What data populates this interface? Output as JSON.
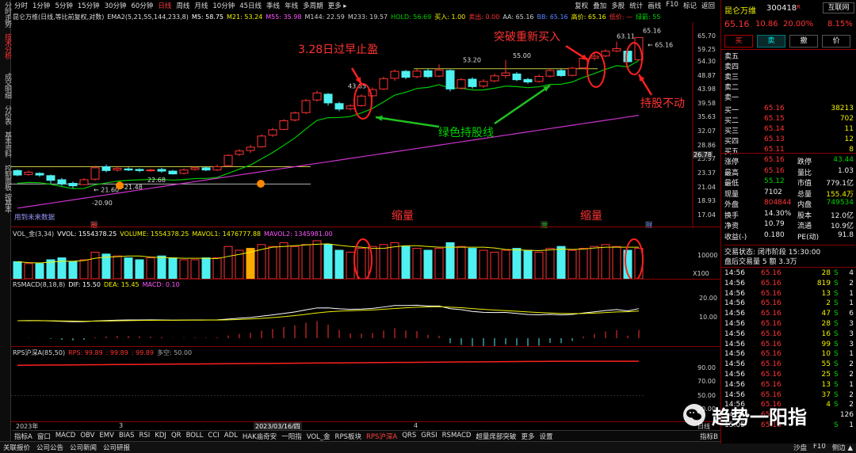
{
  "left_tabs": [
    {
      "label": "分时走势",
      "active": false
    },
    {
      "label": "技术分析",
      "active": true
    },
    {
      "label": "成交明细",
      "active": false
    },
    {
      "label": "分价表",
      "active": false
    },
    {
      "label": "基本资料",
      "active": false
    },
    {
      "label": "控制面板",
      "active": false
    },
    {
      "label": "按基本",
      "active": false
    }
  ],
  "period_tabs": [
    {
      "label": "分时",
      "active": false
    },
    {
      "label": "1分钟",
      "active": false
    },
    {
      "label": "5分钟",
      "active": false
    },
    {
      "label": "15分钟",
      "active": false
    },
    {
      "label": "30分钟",
      "active": false
    },
    {
      "label": "60分钟",
      "active": false
    },
    {
      "label": "日线",
      "active": true
    },
    {
      "label": "周线",
      "active": false
    },
    {
      "label": "月线",
      "active": false
    },
    {
      "label": "10分钟",
      "active": false
    },
    {
      "label": "45日线",
      "active": false
    },
    {
      "label": "季线",
      "active": false
    },
    {
      "label": "年线",
      "active": false
    },
    {
      "label": "多周期",
      "active": false
    },
    {
      "label": "更多 ▸",
      "active": false
    }
  ],
  "right_tools": [
    "复权",
    "叠加",
    "多股",
    "统计",
    "画线",
    "F10",
    "标记",
    "返回"
  ],
  "main_legend": {
    "stock": "昆仑万维(日线,等比前复权,对数)",
    "indicator": "EMA2(5,21,55,144,233,8)",
    "m5": "M5: 58.75",
    "m21": "M21: 53.24",
    "m55": "M55: 35.98",
    "m144": "M144: 22.59",
    "m233": "M233: 19.57",
    "hold": "HOLD: 56.69",
    "buy": "买入: 1.00",
    "sell": "卖出: 0.00",
    "aa": "AA: 65.16",
    "bb": "BB: 65.16",
    "high": "高价: 65.16",
    "low": "低价: —",
    "lvjian": "绿箭: 55"
  },
  "main_axis": [
    "65.70",
    "59.25",
    "54.30",
    "48.87",
    "43.98",
    "39.58",
    "35.63",
    "32.07",
    "28.86",
    "25.97",
    "23.37",
    "21.04",
    "18.93",
    "17.04"
  ],
  "main_axis_highlight": "26.78",
  "price_labels": {
    "p6311": "63.11",
    "p6516a": "65.16",
    "p6516b": "← 65.16",
    "p5500": "55.00",
    "p5320": "53.20",
    "p4365": "43.65",
    "p2160": "← 21.60",
    "p2090": "-20.90",
    "p2148": "-21.48",
    "p2268": "22.68"
  },
  "watermark_text": "用到未来数据",
  "annotations": {
    "a1": "3.28日过早止盈",
    "a2": "突破重新买入",
    "a3": "绿色持股线",
    "a4": "持股不动",
    "a5": "缩量",
    "a6": "缩量"
  },
  "vol_legend": {
    "name": "VOL_金(3,34)",
    "vvol": "VVOL: 1554378.25",
    "volume": "VOLUME: 1554378.25",
    "mavol1": "MAVOL1: 1476777.88",
    "mavol2": "MAVOL2: 1345981.00"
  },
  "vol_axis": [
    "10000",
    "X100"
  ],
  "macd_legend": {
    "name": "RSMACD(8,18,8)",
    "dif": "DIF: 15.50",
    "dea": "DEA: 15.45",
    "macd": "MACD: 0.10"
  },
  "macd_axis": [
    "20.00",
    "10.00"
  ],
  "rps_legend": {
    "name": "RPS沪深A(85,50)",
    "rps": "RPS: 99.89",
    "v2": ": 99.89",
    "v3": ": 99.89",
    "duokong": "多空: 50.00"
  },
  "rps_axis": [
    "90.00",
    "70.00",
    "50.00",
    "30.00"
  ],
  "date_axis": [
    "2023年",
    "3",
    "2023/03/16/四",
    "4",
    "日线"
  ],
  "markers": {
    "m1": "融",
    "m2": "龙",
    "m3": "财"
  },
  "indicator_tabs": [
    "指标A",
    "窗口",
    "MACD",
    "OBV",
    "EMV",
    "BIAS",
    "RSI",
    "KDJ",
    "QR",
    "BOLL",
    "CCI",
    "ADL",
    "HAK庙奇安",
    "一阳指",
    "VOL_金",
    "RPS板块",
    "RPS沪深A",
    "QRS",
    "GRSI",
    "RSMACD",
    "超量席部突破",
    "更多",
    "设置"
  ],
  "indicator_tab_active": "RPS沪深A",
  "indicator_right": "指标B",
  "bottom_bar": [
    "关联报价",
    "公司公告",
    "公司新闻",
    "公司研报"
  ],
  "bottom_right": [
    "沙盘",
    "F10",
    "侧边 ▲"
  ],
  "quote": {
    "name": "昆仑万维",
    "code": "300418",
    "rtag": "R",
    "sector": "互联网",
    "price": "65.16",
    "change": "10.86",
    "pct": "20.00%",
    "sector_pct": "8.15%",
    "buttons": [
      "买",
      "卖",
      "撤",
      "价"
    ],
    "sell_levels": [
      "卖五",
      "卖四",
      "卖三",
      "卖二",
      "卖一"
    ],
    "buy_levels": [
      {
        "label": "买一",
        "price": "65.16",
        "vol": "38213"
      },
      {
        "label": "买二",
        "price": "65.15",
        "vol": "702"
      },
      {
        "label": "买三",
        "price": "65.14",
        "vol": "11"
      },
      {
        "label": "买四",
        "price": "65.13",
        "vol": "12"
      },
      {
        "label": "买五",
        "price": "65.11",
        "vol": "8"
      }
    ],
    "stats": [
      {
        "k1": "涨停",
        "v1": "65.16",
        "k2": "跌停",
        "v2": "43.44"
      },
      {
        "k1": "最高",
        "v1": "65.16",
        "k2": "量比",
        "v2": "1.03"
      },
      {
        "k1": "最低",
        "v1": "55.12",
        "k2": "市值",
        "v2": "779.1亿"
      },
      {
        "k1": "现量",
        "v1": "7102",
        "k2": "总量",
        "v2": "155.4万"
      },
      {
        "k1": "外盘",
        "v1": "804844",
        "k2": "内盘",
        "v2": "749534"
      },
      {
        "k1": "换手",
        "v1": "14.30%",
        "k2": "股本",
        "v2": "12.0亿"
      },
      {
        "k1": "净资",
        "v1": "10.79",
        "k2": "流通",
        "v2": "10.9亿"
      },
      {
        "k1": "收益(-)",
        "v1": "0.180",
        "k2": "PE(动)",
        "v2": "91.8"
      }
    ],
    "status": "交易状态: 闭市阶段 15:30:00",
    "after_hours": "盘后交易量 5 额 3.3万",
    "ticks": [
      {
        "t": "14:56",
        "p": "65.16",
        "v": "28",
        "s": "S",
        "n": "4"
      },
      {
        "t": "14:56",
        "p": "65.16",
        "v": "819",
        "s": "S",
        "n": "2"
      },
      {
        "t": "14:56",
        "p": "65.16",
        "v": "13",
        "s": "S",
        "n": "1"
      },
      {
        "t": "14:56",
        "p": "65.16",
        "v": "2",
        "s": "S",
        "n": "1"
      },
      {
        "t": "14:56",
        "p": "65.16",
        "v": "47",
        "s": "S",
        "n": "6"
      },
      {
        "t": "14:56",
        "p": "65.16",
        "v": "28",
        "s": "S",
        "n": "3"
      },
      {
        "t": "14:56",
        "p": "65.16",
        "v": "16",
        "s": "S",
        "n": "3"
      },
      {
        "t": "14:56",
        "p": "65.16",
        "v": "99",
        "s": "S",
        "n": "3"
      },
      {
        "t": "14:56",
        "p": "65.16",
        "v": "10",
        "s": "S",
        "n": "1"
      },
      {
        "t": "14:56",
        "p": "65.16",
        "v": "55",
        "s": "S",
        "n": "2"
      },
      {
        "t": "14:56",
        "p": "65.16",
        "v": "25",
        "s": "S",
        "n": "2"
      },
      {
        "t": "14:56",
        "p": "65.16",
        "v": "13",
        "s": "S",
        "n": "1"
      },
      {
        "t": "14:56",
        "p": "65.16",
        "v": "37",
        "s": "S",
        "n": "2"
      },
      {
        "t": "14:56",
        "p": "65.16",
        "v": "4",
        "s": "S",
        "n": "2"
      },
      {
        "t": "14:56",
        "p": "65.16",
        "v": "",
        "s": "",
        "n": "126"
      },
      {
        "t": "15:05",
        "p": "65.16",
        "v": "",
        "s": "S",
        "n": "1"
      }
    ]
  },
  "watermark": "趋势一阳指",
  "chart_data": {
    "type": "candlestick",
    "candles": [
      {
        "o": 23.9,
        "c": 23.1,
        "h": 24.1,
        "l": 22.9
      },
      {
        "o": 23.2,
        "c": 23.6,
        "h": 23.9,
        "l": 23.0
      },
      {
        "o": 23.4,
        "c": 23.1,
        "h": 23.6,
        "l": 22.8
      },
      {
        "o": 23.0,
        "c": 22.2,
        "h": 23.2,
        "l": 21.6
      },
      {
        "o": 22.3,
        "c": 21.6,
        "h": 22.6,
        "l": 21.3
      },
      {
        "o": 21.7,
        "c": 21.3,
        "h": 22.0,
        "l": 20.9
      },
      {
        "o": 21.5,
        "c": 22.3,
        "h": 22.6,
        "l": 21.4
      },
      {
        "o": 22.4,
        "c": 24.4,
        "h": 24.8,
        "l": 22.2
      },
      {
        "o": 24.6,
        "c": 23.9,
        "h": 25.0,
        "l": 23.6
      },
      {
        "o": 24.0,
        "c": 24.3,
        "h": 24.7,
        "l": 23.7
      },
      {
        "o": 24.2,
        "c": 24.0,
        "h": 24.5,
        "l": 23.8
      },
      {
        "o": 24.1,
        "c": 23.9,
        "h": 24.3,
        "l": 23.6
      },
      {
        "o": 24.0,
        "c": 24.0,
        "h": 24.2,
        "l": 23.7
      },
      {
        "o": 24.1,
        "c": 23.8,
        "h": 24.4,
        "l": 23.5
      },
      {
        "o": 23.8,
        "c": 23.3,
        "h": 24.0,
        "l": 23.2
      },
      {
        "o": 23.4,
        "c": 24.0,
        "h": 24.3,
        "l": 23.2
      },
      {
        "o": 24.1,
        "c": 24.4,
        "h": 24.7,
        "l": 23.9
      },
      {
        "o": 24.4,
        "c": 24.0,
        "h": 24.6,
        "l": 23.8
      },
      {
        "o": 24.0,
        "c": 24.6,
        "h": 25.0,
        "l": 23.8
      },
      {
        "o": 24.8,
        "c": 26.8,
        "h": 27.0,
        "l": 24.6
      },
      {
        "o": 27.0,
        "c": 27.7,
        "h": 28.1,
        "l": 26.7
      },
      {
        "o": 27.8,
        "c": 28.5,
        "h": 29.0,
        "l": 27.3
      },
      {
        "o": 28.6,
        "c": 31.0,
        "h": 31.4,
        "l": 28.4
      },
      {
        "o": 31.2,
        "c": 32.5,
        "h": 33.0,
        "l": 30.8
      },
      {
        "o": 32.6,
        "c": 34.8,
        "h": 35.2,
        "l": 32.4
      },
      {
        "o": 35.0,
        "c": 36.9,
        "h": 37.3,
        "l": 34.6
      },
      {
        "o": 37.0,
        "c": 40.5,
        "h": 41.0,
        "l": 36.6
      },
      {
        "o": 40.7,
        "c": 42.9,
        "h": 43.65,
        "l": 40.2
      },
      {
        "o": 42.5,
        "c": 39.8,
        "h": 42.9,
        "l": 39.0
      },
      {
        "o": 39.6,
        "c": 38.0,
        "h": 40.1,
        "l": 37.4
      },
      {
        "o": 38.1,
        "c": 38.9,
        "h": 39.4,
        "l": 37.6
      },
      {
        "o": 39.0,
        "c": 41.9,
        "h": 42.4,
        "l": 38.7
      },
      {
        "o": 42.0,
        "c": 44.0,
        "h": 44.7,
        "l": 41.6
      },
      {
        "o": 44.2,
        "c": 47.8,
        "h": 48.5,
        "l": 43.9
      },
      {
        "o": 47.9,
        "c": 50.5,
        "h": 51.2,
        "l": 47.0
      },
      {
        "o": 50.5,
        "c": 48.3,
        "h": 51.0,
        "l": 47.6
      },
      {
        "o": 48.5,
        "c": 50.6,
        "h": 51.3,
        "l": 47.9
      },
      {
        "o": 50.7,
        "c": 48.5,
        "h": 51.5,
        "l": 48.0
      },
      {
        "o": 48.7,
        "c": 51.0,
        "h": 53.2,
        "l": 48.3
      },
      {
        "o": 50.8,
        "c": 44.2,
        "h": 51.2,
        "l": 43.4
      },
      {
        "o": 44.5,
        "c": 47.4,
        "h": 48.0,
        "l": 43.9
      },
      {
        "o": 47.6,
        "c": 45.0,
        "h": 48.3,
        "l": 44.3
      },
      {
        "o": 45.2,
        "c": 46.8,
        "h": 47.6,
        "l": 44.6
      },
      {
        "o": 47.0,
        "c": 48.8,
        "h": 49.7,
        "l": 46.5
      },
      {
        "o": 48.9,
        "c": 49.9,
        "h": 55.0,
        "l": 48.0
      },
      {
        "o": 49.5,
        "c": 47.4,
        "h": 50.2,
        "l": 46.9
      },
      {
        "o": 47.5,
        "c": 46.6,
        "h": 48.1,
        "l": 46.0
      },
      {
        "o": 46.8,
        "c": 48.6,
        "h": 49.3,
        "l": 46.4
      },
      {
        "o": 48.7,
        "c": 50.8,
        "h": 51.5,
        "l": 48.2
      },
      {
        "o": 50.8,
        "c": 48.9,
        "h": 51.4,
        "l": 48.4
      },
      {
        "o": 49.0,
        "c": 51.7,
        "h": 52.3,
        "l": 48.6
      },
      {
        "o": 51.8,
        "c": 55.7,
        "h": 56.4,
        "l": 51.3
      },
      {
        "o": 55.8,
        "c": 56.6,
        "h": 57.9,
        "l": 54.8
      },
      {
        "o": 56.7,
        "c": 58.8,
        "h": 59.6,
        "l": 56.2
      },
      {
        "o": 58.9,
        "c": 59.9,
        "h": 63.11,
        "l": 58.3
      },
      {
        "o": 58.8,
        "c": 54.3,
        "h": 59.4,
        "l": 54.0
      },
      {
        "o": 55.12,
        "c": 65.16,
        "h": 65.16,
        "l": 55.12
      }
    ],
    "vol": [
      9,
      8,
      8,
      10,
      11,
      9,
      10,
      14,
      13,
      12,
      11,
      10,
      11,
      12,
      11,
      10,
      10,
      11,
      11,
      17,
      15,
      16,
      18,
      17,
      19,
      17,
      18,
      20,
      18,
      15,
      14,
      16,
      17,
      18,
      19,
      17,
      16,
      15,
      16,
      19,
      17,
      16,
      15,
      14,
      15,
      16,
      15,
      14,
      16,
      17,
      15,
      16,
      17,
      18,
      17,
      15,
      16
    ],
    "ylim_log": [
      17.04,
      65.7
    ],
    "rps_value": 99.89
  }
}
